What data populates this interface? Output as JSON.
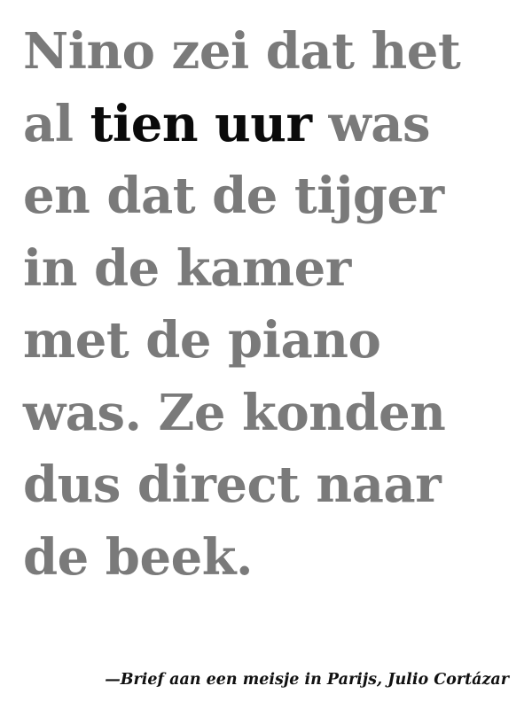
{
  "quote": {
    "lines": [
      {
        "before": "Nino zei dat het",
        "emphasis": "",
        "after": ""
      },
      {
        "before": "al ",
        "emphasis": "tien uur",
        "after": " was"
      },
      {
        "before": "en dat de tijger",
        "emphasis": "",
        "after": ""
      },
      {
        "before": "in de kamer",
        "emphasis": "",
        "after": ""
      },
      {
        "before": "met de piano",
        "emphasis": "",
        "after": ""
      },
      {
        "before": "was. Ze konden",
        "emphasis": "",
        "after": ""
      },
      {
        "before": "dus direct naar",
        "emphasis": "",
        "after": ""
      },
      {
        "before": "de beek.",
        "emphasis": "",
        "after": ""
      }
    ]
  },
  "attribution": "—Brief aan een meisje in Parijs, Julio Cortázar",
  "colors": {
    "body_text": "#7a7a7a",
    "emphasis_text": "#0a0a0a",
    "attribution_text": "#111111",
    "background": "#ffffff"
  }
}
